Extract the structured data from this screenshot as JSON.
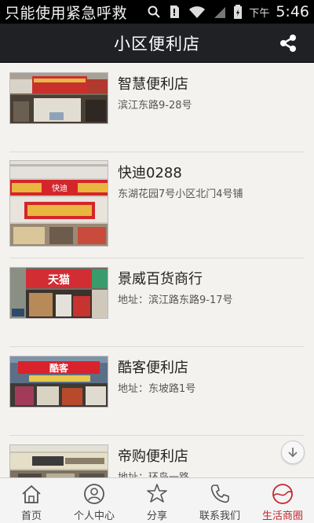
{
  "status_bar": {
    "notice": "只能使用紧急呼救",
    "ampm": "下午",
    "time": "5:46"
  },
  "header": {
    "title": "小区便利店"
  },
  "stores": [
    {
      "name": "智慧便利店",
      "address": "滨江东路9-28号"
    },
    {
      "name": "快迪0288",
      "address": "东湖花园7号小区北门4号铺"
    },
    {
      "name": "景威百货商行",
      "address": "地址：滨江路东路9-17号"
    },
    {
      "name": "酷客便利店",
      "address": "地址：东坡路1号"
    },
    {
      "name": "帝购便利店",
      "address": "地址：环岛一路"
    }
  ],
  "sign_text": {
    "store2_sign": "快迪",
    "store3_sign": "天猫",
    "store4_sign": "酷客"
  },
  "tabs": [
    {
      "label": "首页",
      "icon": "home-icon"
    },
    {
      "label": "个人中心",
      "icon": "user-icon"
    },
    {
      "label": "分享",
      "icon": "share-star-icon"
    },
    {
      "label": "联系我们",
      "icon": "phone-icon"
    },
    {
      "label": "生活商圈",
      "icon": "life-circle-icon"
    }
  ],
  "colors": {
    "active_tab": "#c2272d",
    "title_bar": "#1f2124"
  }
}
